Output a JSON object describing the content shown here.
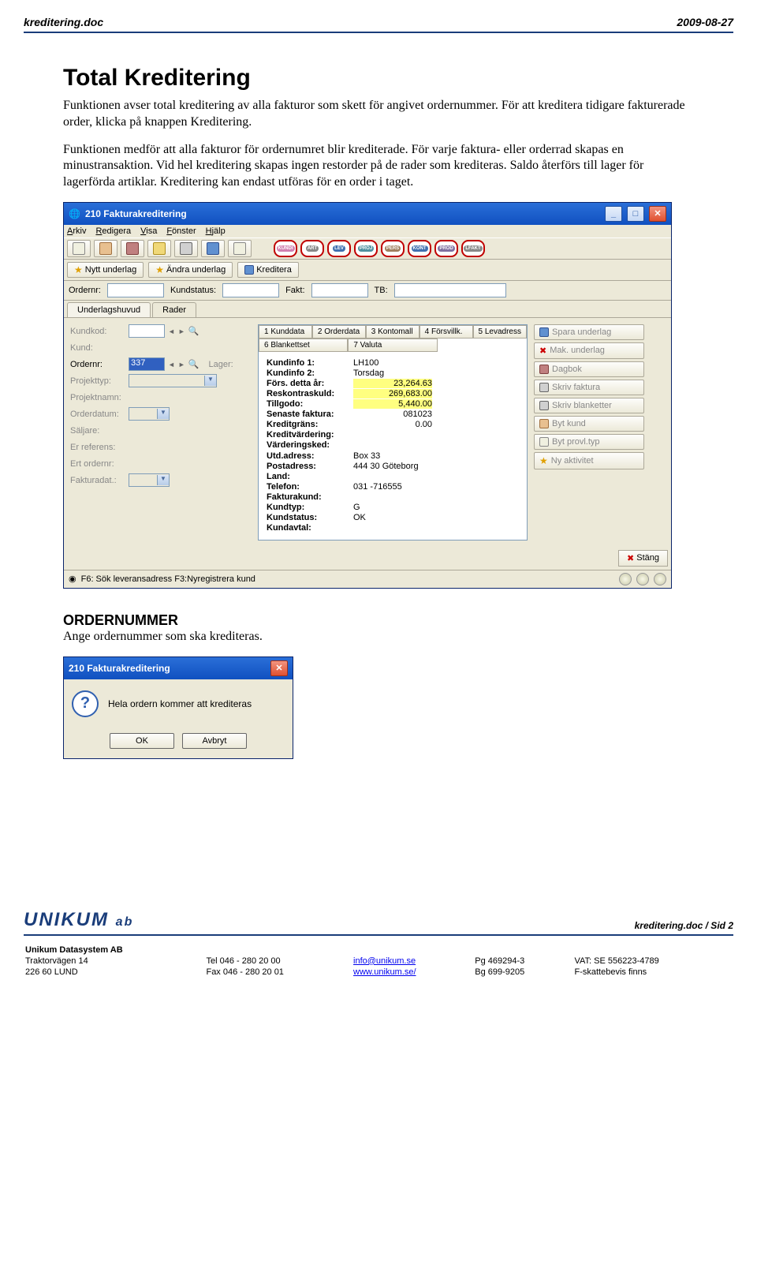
{
  "header": {
    "left": "kreditering.doc",
    "right": "2009-08-27"
  },
  "content": {
    "h1": "Total Kreditering",
    "p1": "Funktionen avser total kreditering av alla fakturor som skett för angivet ordernummer. För att kreditera tidigare fakturerade order, klicka på knappen Kreditering.",
    "p2": "Funktionen medför att alla fakturor för ordernumret blir krediterade. För varje faktura- eller orderrad skapas en minustransaktion. Vid hel kreditering skapas ingen restorder på de rader som krediteras. Saldo återförs till lager för lagerförda artiklar. Kreditering kan endast utföras för en order i taget.",
    "h3": "ORDERNUMMER",
    "p3": "Ange ordernummer som ska krediteras."
  },
  "window": {
    "title": "210 Fakturakreditering",
    "menu": [
      "Arkiv",
      "Redigera",
      "Visa",
      "Fönster",
      "Hjälp"
    ],
    "roundbtns": [
      "KUNDI",
      "ART",
      "LEV",
      "PROJ",
      "PERS",
      "KONT",
      "PROD",
      "LFAKT"
    ],
    "actionbtns": [
      {
        "ico": "star",
        "label": "Nytt underlag"
      },
      {
        "ico": "star",
        "label": "Ändra underlag"
      },
      {
        "ico": "doc",
        "label": "Kreditera"
      }
    ],
    "info": {
      "ordernr": "Ordernr:",
      "kundstatus": "Kundstatus:",
      "fakt": "Fakt:",
      "tb": "TB:"
    },
    "tabs": [
      "Underlagshuvud",
      "Rader"
    ],
    "leftform": {
      "kundkod": "Kundkod:",
      "kund": "Kund:",
      "ordernr": "Ordernr:",
      "ordernr_val": "337",
      "lager": "Lager:",
      "projekttyp": "Projekttyp:",
      "projektnamn": "Projektnamn:",
      "orderdatum": "Orderdatum:",
      "saljare": "Säljare:",
      "erreferens": "Er referens:",
      "ertordernr": "Ert ordernr:",
      "fakturadat": "Fakturadat.:"
    },
    "centertabs": [
      "1 Kunddata",
      "2 Orderdata",
      "3 Kontomall",
      "4 Försvillk.",
      "5 Levadress",
      "6 Blankettset",
      "7 Valuta"
    ],
    "infolist": [
      {
        "l": "Kundinfo 1:",
        "v": "LH100"
      },
      {
        "l": "Kundinfo 2:",
        "v": "Torsdag"
      },
      {
        "l": "Förs. detta år:",
        "v": "23,264.63",
        "hl": true
      },
      {
        "l": "Reskontraskuld:",
        "v": "269,683.00",
        "hl": true
      },
      {
        "l": "Tillgodo:",
        "v": "5,440.00",
        "hl": true
      },
      {
        "l": "Senaste faktura:",
        "v": "081023"
      },
      {
        "l": "Kreditgräns:",
        "v": "0.00"
      },
      {
        "l": "Kreditvärdering:",
        "v": ""
      },
      {
        "l": "Värderingsked:",
        "v": ""
      },
      {
        "l": "",
        "v": ""
      },
      {
        "l": "Utd.adress:",
        "v": "Box 33"
      },
      {
        "l": "Postadress:",
        "v": "444 30 Göteborg"
      },
      {
        "l": "Land:",
        "v": ""
      },
      {
        "l": "Telefon:",
        "v": "031 -716555"
      },
      {
        "l": "Fakturakund:",
        "v": ""
      },
      {
        "l": "Kundtyp:",
        "v": "G"
      },
      {
        "l": "Kundstatus:",
        "v": "OK"
      },
      {
        "l": "Kundavtal:",
        "v": ""
      }
    ],
    "rightbtns": [
      "Spara underlag",
      "Mak. underlag",
      "Dagbok",
      "Skriv faktura",
      "Skriv blanketter",
      "Byt kund",
      "Byt provl.typ",
      "Ny aktivitet"
    ],
    "stang": "Stäng",
    "status": "F6: Sök leveransadress F3:Nyregistrera kund"
  },
  "dialog": {
    "title": "210 Fakturakreditering",
    "msg": "Hela ordern kommer att krediteras",
    "ok": "OK",
    "cancel": "Avbryt"
  },
  "footer": {
    "brand": "UNIKUM",
    "ab": "ab",
    "pgno": "kreditering.doc / Sid 2",
    "company": "Unikum Datasystem AB",
    "addr1": "Traktorvägen 14",
    "addr2": "226 60  LUND",
    "tel": "Tel  046 - 280 20 00",
    "fax": "Fax  046 - 280 20 01",
    "email": "info@unikum.se",
    "web": "www.unikum.se/",
    "pg": "Pg  469294-3",
    "bg": "Bg  699-9205",
    "vat": "VAT: SE 556223-4789",
    "fsk": "F-skattebevis finns"
  }
}
